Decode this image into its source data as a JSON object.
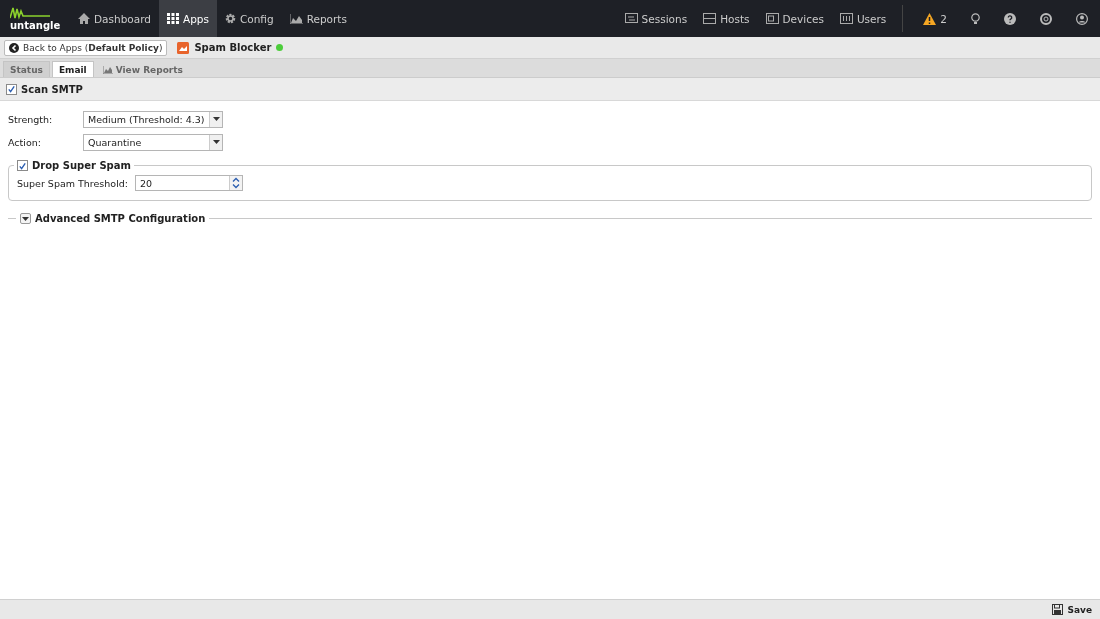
{
  "logo": {
    "text": "untangle"
  },
  "nav": [
    {
      "label": "Dashboard",
      "selected": false
    },
    {
      "label": "Apps",
      "selected": true
    },
    {
      "label": "Config",
      "selected": false
    },
    {
      "label": "Reports",
      "selected": false
    }
  ],
  "nav_right": [
    {
      "label": "Sessions"
    },
    {
      "label": "Hosts"
    },
    {
      "label": "Devices"
    },
    {
      "label": "Users"
    }
  ],
  "alerts": {
    "count": "2"
  },
  "breadcrumb": {
    "back": "Back to Apps (**Default Policy**)",
    "app": "Spam Blocker",
    "running": true
  },
  "tabs": [
    {
      "label": "Status",
      "selected": false
    },
    {
      "label": "Email",
      "selected": true
    },
    {
      "label": "View Reports",
      "selected": false
    }
  ],
  "scan_smtp": {
    "label": "Scan SMTP",
    "checked": true
  },
  "fields": [
    {
      "label": "Strength:",
      "value": "Medium (Threshold: 4.3)"
    },
    {
      "label": "Action:",
      "value": "Quarantine"
    }
  ],
  "drop_super_spam": {
    "label": "Drop Super Spam",
    "checked": true,
    "threshold_label": "Super Spam Threshold:",
    "threshold_value": "20"
  },
  "advanced": {
    "label": "Advanced SMTP Configuration",
    "expanded": false
  },
  "footer": {
    "save": "Save"
  }
}
